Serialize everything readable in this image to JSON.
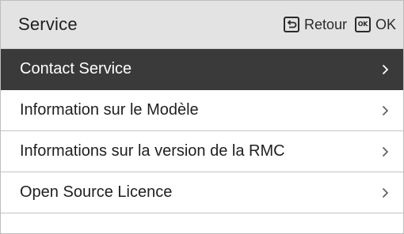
{
  "header": {
    "title": "Service",
    "back_label": "Retour",
    "ok_icon_text": "OK",
    "ok_label": "OK"
  },
  "menu": {
    "items": [
      {
        "label": "Contact Service",
        "selected": true
      },
      {
        "label": "Information sur le Modèle",
        "selected": false
      },
      {
        "label": "Informations sur la version de la RMC",
        "selected": false
      },
      {
        "label": "Open Source Licence",
        "selected": false
      }
    ]
  },
  "colors": {
    "header_bg": "#e3e3e3",
    "selected_bg": "#3a3a3a",
    "selected_text": "#ffffff",
    "text": "#1f1f1f",
    "divider": "#c4c4c4"
  },
  "icons": {
    "back": "back-arrow-icon",
    "ok": "ok-key-icon",
    "chevron": "chevron-right-icon"
  }
}
